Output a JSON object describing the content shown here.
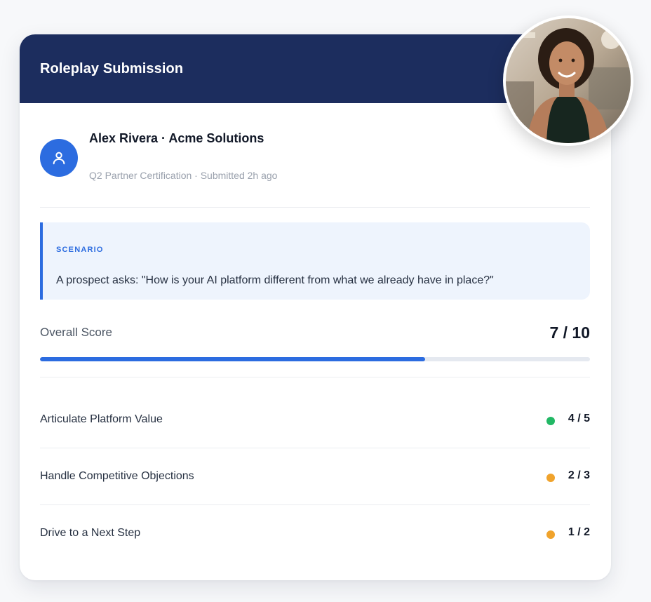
{
  "card": {
    "title": "Roleplay Submission"
  },
  "user": {
    "name": "Alex Rivera · Acme Solutions",
    "subtitle": "Q2 Partner Certification · Submitted 2h ago"
  },
  "scenario": {
    "label": "SCENARIO",
    "text": "A prospect asks: \"How is your AI platform different from what we already have in place?\""
  },
  "overall": {
    "label": "Overall Score",
    "value_text": "7 / 10",
    "progress_fraction": 0.7
  },
  "criteria": [
    {
      "label": "Articulate Platform Value",
      "score": "4 / 5",
      "status_color": "#22b865"
    },
    {
      "label": "Handle Competitive Objections",
      "score": "2 / 3",
      "status_color": "#f0a32c"
    },
    {
      "label": "Drive to a Next Step",
      "score": "1 / 2",
      "status_color": "#f0a32c"
    }
  ],
  "colors": {
    "header": "#1c2d5e",
    "accent": "#2c6ce0"
  },
  "icons": {
    "avatar": "user-icon"
  }
}
